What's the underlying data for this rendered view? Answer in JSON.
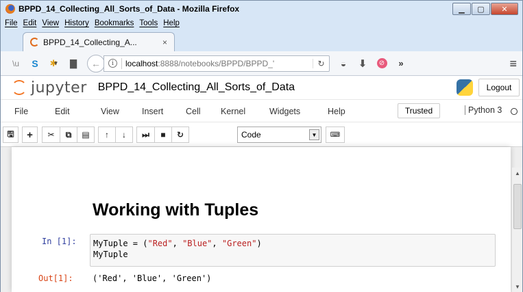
{
  "window": {
    "title": "BPPD_14_Collecting_All_Sorts_of_Data - Mozilla Firefox"
  },
  "browser_menu": [
    "File",
    "Edit",
    "View",
    "History",
    "Bookmarks",
    "Tools",
    "Help"
  ],
  "tab": {
    "title": "BPPD_14_Collecting_A...",
    "close": "×"
  },
  "urlbar": {
    "host": "localhost",
    "path": ":8888/notebooks/BPPD/BPPD_'"
  },
  "jupyter": {
    "logo_text": "jupyter",
    "notebook_name": "BPPD_14_Collecting_All_Sorts_of_Data",
    "logout_label": "Logout",
    "menu": [
      "File",
      "Edit",
      "View",
      "Insert",
      "Cell",
      "Kernel",
      "Widgets",
      "Help"
    ],
    "trusted_label": "Trusted",
    "kernel_label": "Python 3",
    "cell_type": "Code"
  },
  "notebook": {
    "heading": "Working with Tuples",
    "in_prompt": "In [1]:",
    "code": {
      "line1_var": "MyTuple = (",
      "str1": "\"Red\"",
      "sep1": ", ",
      "str2": "\"Blue\"",
      "sep2": ", ",
      "str3": "\"Green\"",
      "close": ")",
      "line2": "MyTuple"
    },
    "out_prompt": "Out[1]:",
    "output": "('Red', 'Blue', 'Green')"
  }
}
